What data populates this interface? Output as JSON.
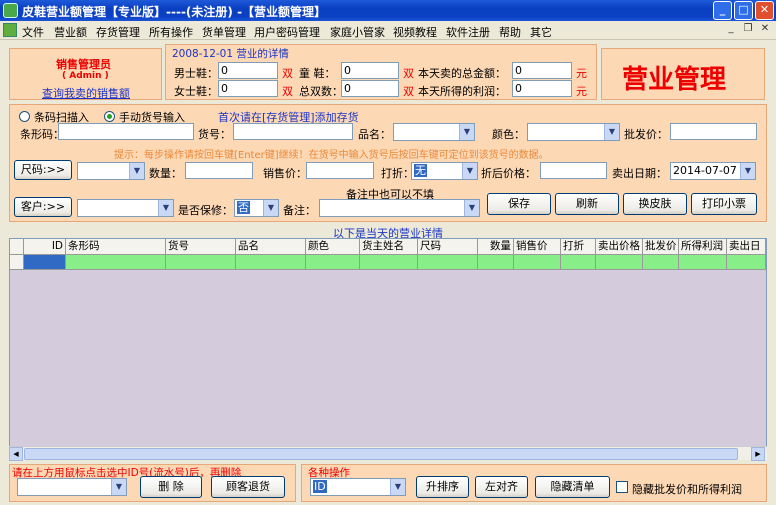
{
  "window": {
    "title": "皮鞋营业额管理【专业版】----(未注册) -【营业额管理】"
  },
  "menu": [
    "文件",
    "营业额",
    "存货管理",
    "所有操作",
    "货单管理",
    "用户密码管理",
    "家庭小管家",
    "视频教程",
    "软件注册",
    "帮助",
    "其它"
  ],
  "account": {
    "role": "销售管理员",
    "user": "( Admin )",
    "link": "查询我卖的销售额"
  },
  "summary": {
    "legend": "2008-12-01 营业的详情",
    "men_label": "男士鞋：",
    "men": "0",
    "women_label": "女士鞋：",
    "women": "0",
    "pair": "双",
    "kids_label": "童  鞋：",
    "kids": "0",
    "total_pairs_label": "总双数：",
    "total_pairs": "0",
    "total_sales_label": "本天卖的总金额：",
    "total_sales": "0",
    "profit_label": "本天所得的利润：",
    "profit": "0",
    "yuan": "元"
  },
  "big_title": "营业管理",
  "entry": {
    "radio_barcode": "条码扫描入",
    "radio_manual": "手动货号输入",
    "hint_top": "首次请在[存货管理]添加存货",
    "barcode_label": "条形码：",
    "item_no_label": "货号：",
    "name_label": "品名：",
    "color_label": "颜色：",
    "wholesale_label": "批发价：",
    "tip": "提示：每步操作请按回车键[Enter键]继续！在货号中输入货号后按回车键可定位到该货号的数据。",
    "size_btn": "尺码:>>",
    "qty_label": "数量：",
    "price_label": "销售价：",
    "discount_label": "打折：",
    "discount_value": "无",
    "after_label": "折后价格：",
    "date_label": "卖出日期：",
    "date_value": "2014-07-07",
    "remark_hint": "备注中也可以不填",
    "customer_btn": "客户:>>",
    "warranty_label": "是否保修：",
    "warranty_value": "否",
    "remark_label": "备注：",
    "save": "保存",
    "refresh": "刷新",
    "skin": "换皮肤",
    "print": "打印小票"
  },
  "table": {
    "caption": "以下是当天的营业详情",
    "columns": [
      "ID",
      "条形码",
      "货号",
      "品名",
      "颜色",
      "货主姓名",
      "尺码",
      "数量",
      "销售价",
      "打折",
      "卖出价格",
      "批发价",
      "所得利润",
      "卖出日"
    ]
  },
  "bottom": {
    "delete_legend": "请在上方用鼠标点击选中ID号(流水号)后，再删除",
    "delete": "删 除",
    "return": "顾客退货",
    "ops_legend": "各种操作",
    "ops_value": "ID",
    "sort": "升排序",
    "align": "左对齐",
    "hide_list": "隐藏清单",
    "hide_check": "隐藏批发价和所得利润"
  }
}
